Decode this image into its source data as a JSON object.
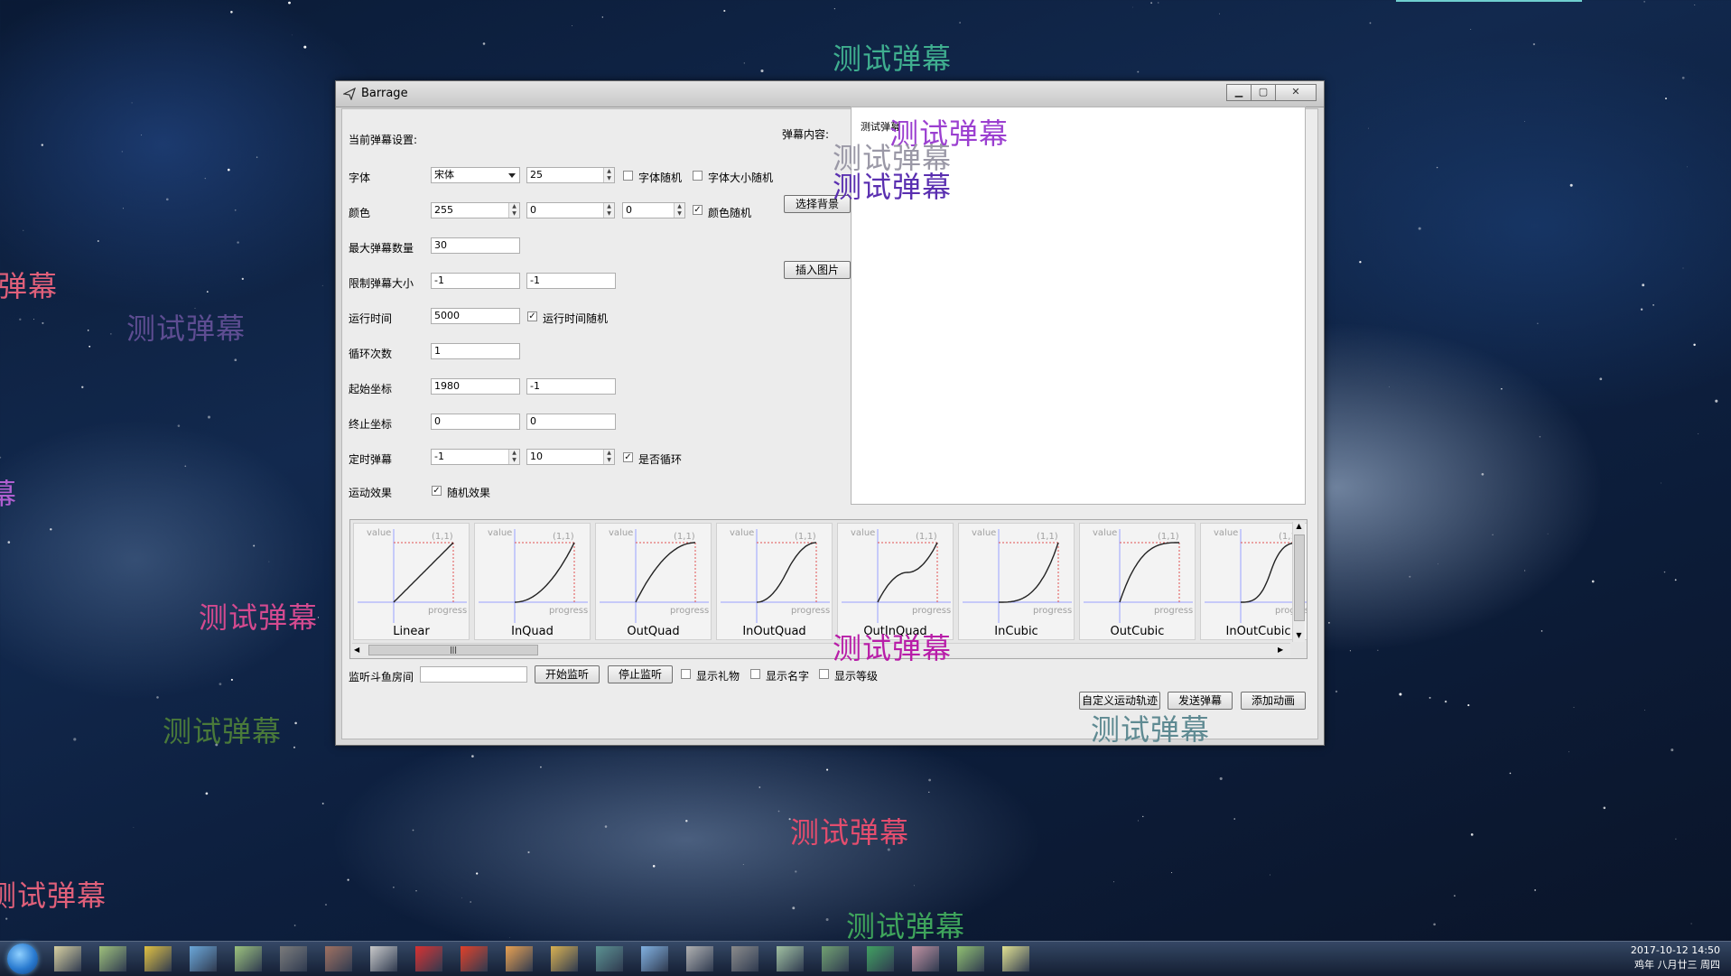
{
  "window": {
    "title": "Barrage"
  },
  "form": {
    "current_settings_label": "当前弹幕设置:",
    "font": {
      "label": "字体",
      "family": "宋体",
      "size": "25",
      "random_font_label": "字体随机",
      "random_font_checked": false,
      "random_size_label": "字体大小随机",
      "random_size_checked": false
    },
    "color": {
      "label": "颜色",
      "r": "255",
      "g": "0",
      "b": "0",
      "random_label": "颜色随机",
      "random_checked": true
    },
    "max_count": {
      "label": "最大弹幕数量",
      "value": "30"
    },
    "size_limit": {
      "label": "限制弹幕大小",
      "w": "-1",
      "h": "-1"
    },
    "run_time": {
      "label": "运行时间",
      "value": "5000",
      "random_label": "运行时间随机",
      "random_checked": true
    },
    "loop_count": {
      "label": "循环次数",
      "value": "1"
    },
    "start_coord": {
      "label": "起始坐标",
      "x": "1980",
      "y": "-1"
    },
    "end_coord": {
      "label": "终止坐标",
      "x": "0",
      "y": "0"
    },
    "timed": {
      "label": "定时弹幕",
      "value": "-1",
      "interval": "10",
      "loop_label": "是否循环",
      "loop_checked": true
    },
    "motion": {
      "label": "运动效果",
      "random_label": "随机效果",
      "random_checked": true
    }
  },
  "content": {
    "label": "弹幕内容:",
    "select_bg_button": "选择背景",
    "insert_image_button": "插入图片",
    "text": "测试弹幕"
  },
  "curves": {
    "axis_value": "value",
    "axis_progress": "progress",
    "point": "(1,1)",
    "items": [
      "Linear",
      "InQuad",
      "OutQuad",
      "InOutQuad",
      "OutInQuad",
      "InCubic",
      "OutCubic",
      "InOutCubic"
    ]
  },
  "listen": {
    "label": "监听斗鱼房间",
    "room_value": "",
    "start_button": "开始监听",
    "stop_button": "停止监听",
    "show_gift_label": "显示礼物",
    "show_name_label": "显示名字",
    "show_level_label": "显示等级"
  },
  "actions": {
    "custom_path_button": "自定义运动轨迹",
    "send_button": "发送弹幕",
    "add_anim_button": "添加动画"
  },
  "danmaku": [
    {
      "text": "测试弹幕",
      "color": "#3fae8f"
    },
    {
      "text": "测试弹幕",
      "color": "#9b3fd0"
    },
    {
      "text": "测试弹幕",
      "color": "#9a98a6"
    },
    {
      "text": "测试弹幕",
      "color": "#5a2fb0"
    },
    {
      "text": "测试弹幕",
      "color": "#c04a7a"
    },
    {
      "text": "测试弹幕",
      "color": "#5e4d92"
    },
    {
      "text": "测试弹幕",
      "color": "#d44a8f"
    },
    {
      "text": "测试弹幕",
      "color": "#4a7a3a"
    },
    {
      "text": "测试弹幕",
      "color": "#b81da8"
    },
    {
      "text": "测试弹幕",
      "color": "#5f8a92"
    },
    {
      "text": "测试弹幕",
      "color": "#e34d6e"
    },
    {
      "text": "测试弹幕",
      "color": "#e0607a"
    },
    {
      "text": "测试弹幕",
      "color": "#3fa55c"
    },
    {
      "text": "弹幕",
      "color": "#e0607a"
    },
    {
      "text": "幕",
      "color": "#b05fd0"
    }
  ],
  "taskbar": {
    "clock_time": "2017-10-12 14:50",
    "clock_date": "鸡年 八月廿三 周四"
  }
}
